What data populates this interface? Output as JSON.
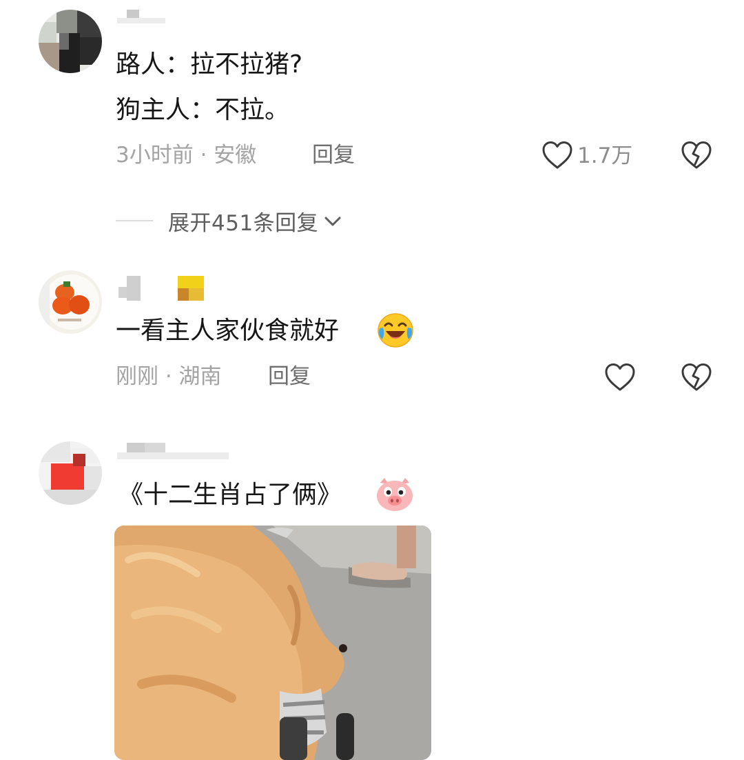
{
  "comments": [
    {
      "username": "",
      "lines": [
        "路人：拉不拉猪?",
        "狗主人：不拉。"
      ],
      "time_location": "3小时前 · 安徽",
      "reply_label": "回复",
      "like_count": "1.7万",
      "like_icon": "heart-outline-icon",
      "dislike_icon": "broken-heart-icon",
      "expand_replies": "展开451条回复"
    },
    {
      "username": "",
      "text": "一看主人家伙食就好",
      "emoji": "crying-laughing-emoji",
      "time_location": "刚刚 · 湖南",
      "reply_label": "回复",
      "like_icon": "heart-outline-icon",
      "dislike_icon": "broken-heart-icon"
    },
    {
      "username": "",
      "text": "《十二生肖占了俩》",
      "emoji": "pig-face-emoji",
      "media_description": "golden retriever walking on street"
    }
  ],
  "colors": {
    "primary_text": "#161616",
    "meta_text": "#a3a3a3",
    "reply_text": "#6e6e6e",
    "icon_stroke": "#3a3a3a",
    "background": "#ffffff"
  }
}
